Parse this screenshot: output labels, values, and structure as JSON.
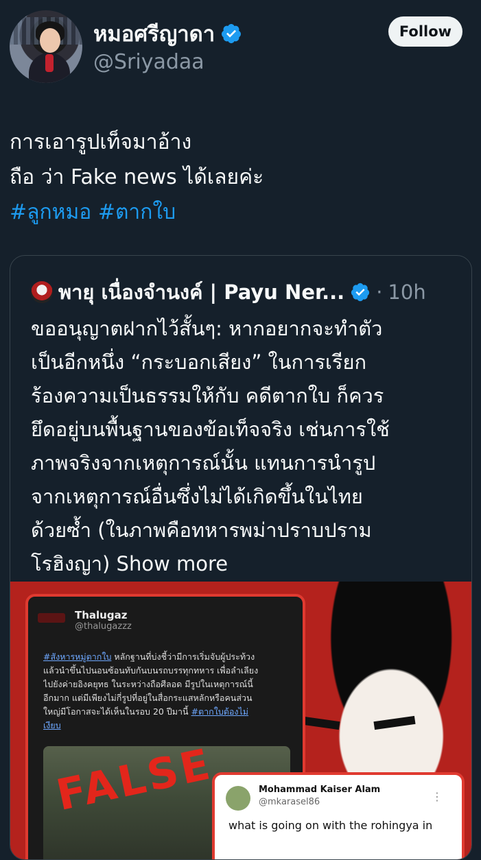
{
  "author": {
    "name": "หมอศรีญาดา",
    "handle": "@Sriyadaa",
    "follow_label": "Follow"
  },
  "tweet": {
    "lines": [
      "การเอารูปเท็จมาอ้าง",
      "ถือ ว่า Fake news ได้เลยค่ะ"
    ],
    "hashtags": [
      "#ลูกหมอ",
      "#ตากใบ"
    ]
  },
  "quote": {
    "name": "พายุ เนื่องจำนงค์ | Payu Ner...",
    "separator": "·",
    "time": "10h",
    "lines": [
      "ขออนุญาตฝากไว้สั้นๆ: หากอยากจะทำตัว",
      "เป็นอีกหนึ่ง “กระบอกเสียง” ในการเรียก",
      "ร้องความเป็นธรรมให้กับ คดีตากใบ ก็ควร",
      "ยึดอยู่บนพื้นฐานของข้อเท็จจริง เช่นการใช้",
      "ภาพจริงจากเหตุการณ์นั้น แทนการนำรูป",
      "จากเหตุการณ์อื่นซึ่งไม่ได้เกิดขึ้นในไทย",
      "ด้วยซ้ำ (ในภาพคือทหารพม่าปราบปราม"
    ],
    "last_line": "โรฮิงญา)",
    "show_more": "Show more",
    "media": {
      "card1": {
        "name": "Thalugaz",
        "handle": "@thalugazzz",
        "link1": "#สังหารหมู่ตากใบ",
        "line1": " หลักฐานที่บ่งชี้ว่ามีการเริ่มจับผู้ประท้วง",
        "line2": "แล้วนำขึ้นไปนอนซ้อนทับกันบนรถบรรทุกทหาร เพื่อลำเลียง",
        "line3": "ไปยังค่ายอิงคยุทธ ในระหว่างถือศีลอด มีรูปในเหตุการณ์นี้",
        "line4": "อีกมาก แต่มีเพียงไม่กี่รูปที่อยู่ในสื่อกระแสหลักหรือคนส่วน",
        "line5": "ใหญ่มีโอกาสจะได้เห็นในรอบ 20 ปีมานี้",
        "link2": "#ตากใบต้องไม่",
        "link3": "เงียบ"
      },
      "stamp": "FALSE",
      "card2": {
        "name": "Mohammad Kaiser Alam",
        "handle": "@mkarasel86",
        "text": "what is going on with the rohingya in",
        "more": "⋮"
      }
    }
  },
  "colors": {
    "background": "#15202b",
    "accent": "#1d9bf0",
    "secondary_text": "#8b98a5"
  },
  "icons": [
    "verified-badge-icon",
    "avatar",
    "quote-avatar"
  ]
}
